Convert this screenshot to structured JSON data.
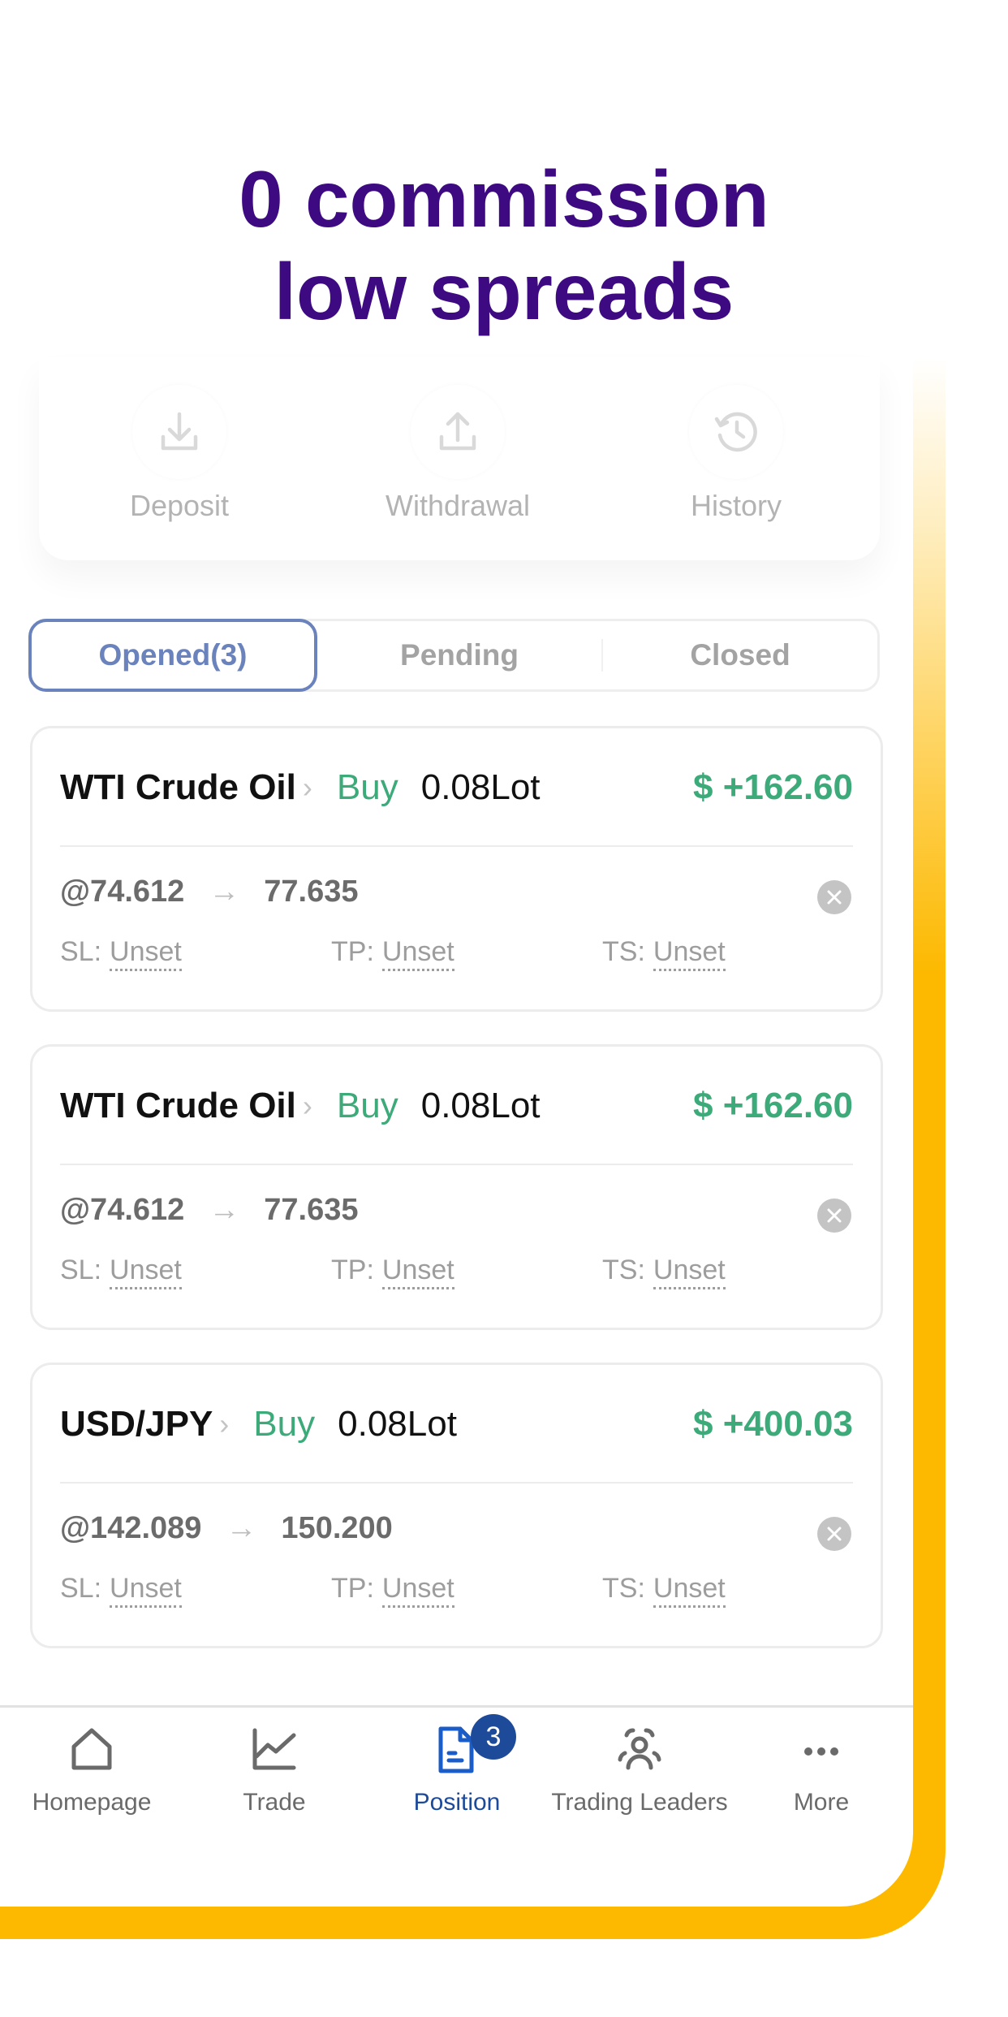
{
  "headline": {
    "line1": "0 commission",
    "line2": "low spreads"
  },
  "colors": {
    "brand_purple": "#3E0A82",
    "frame_yellow": "#FDB900",
    "profit_green": "#3DAA7A",
    "active_blue": "#1E4A9A",
    "tab_active": "#6B83BC"
  },
  "quick_actions": [
    {
      "label": "Deposit",
      "icon": "download-icon"
    },
    {
      "label": "Withdrawal",
      "icon": "upload-icon"
    },
    {
      "label": "History",
      "icon": "history-icon"
    }
  ],
  "position_tabs": [
    {
      "label": "Opened(3)",
      "active": true
    },
    {
      "label": "Pending",
      "active": false
    },
    {
      "label": "Closed",
      "active": false
    }
  ],
  "positions": [
    {
      "symbol": "WTI Crude Oil",
      "side": "Buy",
      "lot": "0.08Lot",
      "pnl": "$ +162.60",
      "open_price": "@74.612",
      "current_price": "77.635",
      "sl_label": "SL:",
      "sl": "Unset",
      "tp_label": "TP:",
      "tp": "Unset",
      "ts_label": "TS:",
      "ts": "Unset"
    },
    {
      "symbol": "WTI Crude Oil",
      "side": "Buy",
      "lot": "0.08Lot",
      "pnl": "$ +162.60",
      "open_price": "@74.612",
      "current_price": "77.635",
      "sl_label": "SL:",
      "sl": "Unset",
      "tp_label": "TP:",
      "tp": "Unset",
      "ts_label": "TS:",
      "ts": "Unset"
    },
    {
      "symbol": "USD/JPY",
      "side": "Buy",
      "lot": "0.08Lot",
      "pnl": "$ +400.03",
      "open_price": "@142.089",
      "current_price": "150.200",
      "sl_label": "SL:",
      "sl": "Unset",
      "tp_label": "TP:",
      "tp": "Unset",
      "ts_label": "TS:",
      "ts": "Unset"
    }
  ],
  "arrow_glyph": "→",
  "chevron_glyph": "›",
  "tabbar": [
    {
      "label": "Homepage",
      "icon": "home-icon",
      "active": false
    },
    {
      "label": "Trade",
      "icon": "chart-line-icon",
      "active": false
    },
    {
      "label": "Position",
      "icon": "document-icon",
      "active": true,
      "badge": "3"
    },
    {
      "label": "Trading Leaders",
      "icon": "users-icon",
      "active": false
    },
    {
      "label": "More",
      "icon": "more-dots-icon",
      "active": false
    }
  ]
}
